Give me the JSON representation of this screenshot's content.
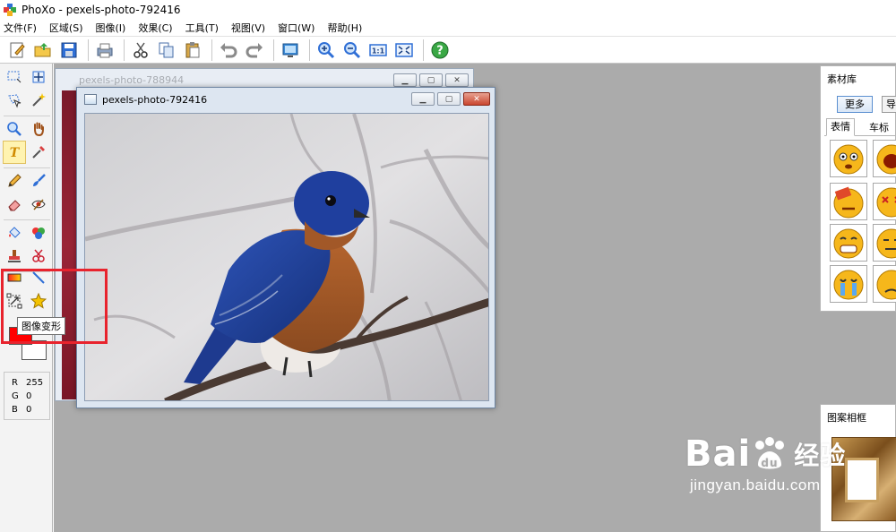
{
  "app": {
    "title": "PhoXo - pexels-photo-792416"
  },
  "menu": [
    "文件(F)",
    "区域(S)",
    "图像(I)",
    "效果(C)",
    "工具(T)",
    "视图(V)",
    "窗口(W)",
    "帮助(H)"
  ],
  "toolbar_icons": [
    "new-icon",
    "open-icon",
    "save-icon",
    "print-icon",
    "cut-icon",
    "copy-icon",
    "paste-icon",
    "undo-icon",
    "redo-icon",
    "screen-capture-icon",
    "zoom-in-icon",
    "zoom-out-icon",
    "actual-size-icon",
    "fit-window-icon",
    "help-icon"
  ],
  "toolbox": {
    "tooltip": "图像变形",
    "foreground_color": "#ff0000",
    "background_color": "#ffffff",
    "rgb": {
      "r_label": "R",
      "r": "255",
      "g_label": "G",
      "g": "0",
      "b_label": "B",
      "b": "0"
    }
  },
  "windows": {
    "background": {
      "title": "pexels-photo-788944"
    },
    "foreground": {
      "title": "pexels-photo-792416"
    }
  },
  "materials_panel": {
    "title": "素材库",
    "more_button": "更多",
    "import_button": "导",
    "tabs": [
      "表情",
      "车标"
    ]
  },
  "frames_panel": {
    "title": "图案相框"
  },
  "watermark": {
    "brand": "Bai",
    "brand2": "经验",
    "url": "jingyan.baidu.com"
  },
  "colors": {
    "highlight": "#e8232d",
    "workspace": "#ababab"
  }
}
